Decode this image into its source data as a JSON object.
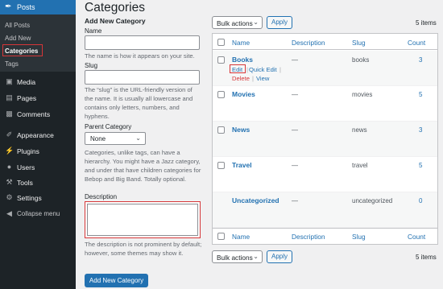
{
  "sidebar": {
    "posts_label": "Posts",
    "submenu": [
      "All Posts",
      "Add New",
      "Categories",
      "Tags"
    ],
    "items": [
      {
        "label": "Media",
        "icon": "media-icon"
      },
      {
        "label": "Pages",
        "icon": "pages-icon"
      },
      {
        "label": "Comments",
        "icon": "comments-icon"
      },
      {
        "label": "Appearance",
        "icon": "appearance-icon"
      },
      {
        "label": "Plugins",
        "icon": "plugins-icon"
      },
      {
        "label": "Users",
        "icon": "users-icon"
      },
      {
        "label": "Tools",
        "icon": "tools-icon"
      },
      {
        "label": "Settings",
        "icon": "settings-icon"
      },
      {
        "label": "Collapse menu",
        "icon": "collapse-icon"
      }
    ],
    "active_color": "#2271b1"
  },
  "page_title": "Categories",
  "form": {
    "heading": "Add New Category",
    "name_label": "Name",
    "name_help": "The name is how it appears on your site.",
    "slug_label": "Slug",
    "slug_help": "The “slug” is the URL-friendly version of the name. It is usually all lowercase and contains only letters, numbers, and hyphens.",
    "parent_label": "Parent Category",
    "parent_value": "None",
    "parent_help": "Categories, unlike tags, can have a hierarchy. You might have a Jazz category, and under that have children categories for Bebop and Big Band. Totally optional.",
    "description_label": "Description",
    "description_help": "The description is not prominent by default; however, some themes may show it.",
    "submit_label": "Add New Category"
  },
  "list": {
    "bulk_label": "Bulk actions",
    "apply_label": "Apply",
    "items_count": "5 items",
    "columns": {
      "name": "Name",
      "description": "Description",
      "slug": "Slug",
      "count": "Count"
    },
    "rows": [
      {
        "name": "Books",
        "description": "—",
        "slug": "books",
        "count": "3"
      },
      {
        "name": "Movies",
        "description": "—",
        "slug": "movies",
        "count": "5"
      },
      {
        "name": "News",
        "description": "—",
        "slug": "news",
        "count": "3"
      },
      {
        "name": "Travel",
        "description": "—",
        "slug": "travel",
        "count": "5"
      },
      {
        "name": "Uncategorized",
        "description": "—",
        "slug": "uncategorized",
        "count": "0"
      }
    ],
    "row_actions": {
      "edit": "Edit",
      "quick_edit": "Quick Edit",
      "delete": "Delete",
      "view": "View",
      "separator": "|"
    }
  }
}
